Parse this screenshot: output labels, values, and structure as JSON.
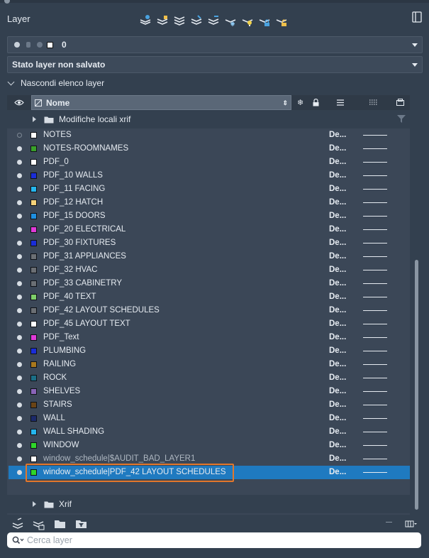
{
  "panel": {
    "title": "Layer"
  },
  "current_layer": {
    "name": "0"
  },
  "layer_state": {
    "value": "Stato layer non salvato"
  },
  "toggle_list": {
    "label": "Nascondi elenco layer"
  },
  "columns": {
    "name": "Nome"
  },
  "groups": {
    "local_xref": "Modifiche locali xrif",
    "xref": "Xrif"
  },
  "layers": [
    {
      "name": "NOTES",
      "color": "#ffffff",
      "visible": false,
      "linetype": "De..."
    },
    {
      "name": "NOTES-ROOMNAMES",
      "color": "#3aa02a",
      "visible": true,
      "linetype": "De..."
    },
    {
      "name": "PDF_0",
      "color": "#ffffff",
      "visible": true,
      "linetype": "De..."
    },
    {
      "name": "PDF_10 WALLS",
      "color": "#1a2dd8",
      "visible": true,
      "linetype": "De..."
    },
    {
      "name": "PDF_11 FACING",
      "color": "#25b6ee",
      "visible": true,
      "linetype": "De..."
    },
    {
      "name": "PDF_12 HATCH",
      "color": "#f4d27a",
      "visible": true,
      "linetype": "De..."
    },
    {
      "name": "PDF_15 DOORS",
      "color": "#1e8fe0",
      "visible": true,
      "linetype": "De..."
    },
    {
      "name": "PDF_20 ELECTRICAL",
      "color": "#e03ad8",
      "visible": true,
      "linetype": "De..."
    },
    {
      "name": "PDF_30 FIXTURES",
      "color": "#1a2dd8",
      "visible": true,
      "linetype": "De..."
    },
    {
      "name": "PDF_31 APPLIANCES",
      "color": "#6b6f74",
      "visible": true,
      "linetype": "De..."
    },
    {
      "name": "PDF_32 HVAC",
      "color": "#6b6f74",
      "visible": true,
      "linetype": "De..."
    },
    {
      "name": "PDF_33 CABINETRY",
      "color": "#6b6f74",
      "visible": true,
      "linetype": "De..."
    },
    {
      "name": "PDF_40 TEXT",
      "color": "#7ecf6a",
      "visible": true,
      "linetype": "De..."
    },
    {
      "name": "PDF_42 LAYOUT SCHEDULES",
      "color": "#6b6f74",
      "visible": true,
      "linetype": "De..."
    },
    {
      "name": "PDF_45 LAYOUT TEXT",
      "color": "#ffffff",
      "visible": true,
      "linetype": "De..."
    },
    {
      "name": "PDF_Text",
      "color": "#e03ad8",
      "visible": true,
      "linetype": "De..."
    },
    {
      "name": "PLUMBING",
      "color": "#1a2dd8",
      "visible": true,
      "linetype": "De..."
    },
    {
      "name": "RAILING",
      "color": "#a8781e",
      "visible": true,
      "linetype": "De..."
    },
    {
      "name": "ROCK",
      "color": "#1b6e86",
      "visible": true,
      "linetype": "De..."
    },
    {
      "name": "SHELVES",
      "color": "#8a64b8",
      "visible": true,
      "linetype": "De..."
    },
    {
      "name": "STAIRS",
      "color": "#6a4416",
      "visible": true,
      "linetype": "De..."
    },
    {
      "name": "WALL",
      "color": "#1c2a6a",
      "visible": true,
      "linetype": "De..."
    },
    {
      "name": "WALL SHADING",
      "color": "#25b6ee",
      "visible": true,
      "linetype": "De..."
    },
    {
      "name": "WINDOW",
      "color": "#2fd62a",
      "visible": true,
      "linetype": "De..."
    },
    {
      "name": "window_schedule|$AUDIT_BAD_LAYER1",
      "color": "#ffffff",
      "visible": true,
      "linetype": "De...",
      "dim": true
    },
    {
      "name": "window_schedule|PDF_42 LAYOUT SCHEDULES",
      "color": "#2fd62a",
      "visible": true,
      "linetype": "De...",
      "selected": true
    }
  ],
  "search": {
    "placeholder": "Cerca layer"
  },
  "icons": {
    "toolbar": [
      "new-layer-icon",
      "new-layer-vp-frozen-icon",
      "layer-walk-icon",
      "layer-match-icon",
      "layer-previous-icon",
      "freeze-icon",
      "isolate-icon",
      "lock-icon",
      "unlock-icon"
    ],
    "bottom": [
      "layer-properties-icon",
      "layer-filter-icon",
      "new-group-filter-icon",
      "new-property-filter-icon",
      "collapse-icon",
      "column-settings-icon"
    ]
  },
  "colors": {
    "selection": "#1f7ac0",
    "highlight_border": "#e2772b"
  }
}
